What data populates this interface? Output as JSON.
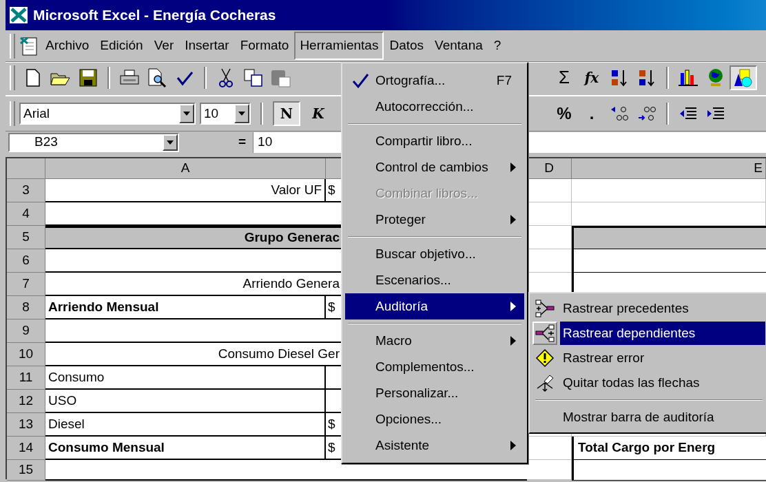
{
  "window": {
    "title": "Microsoft Excel - Energía Cocheras"
  },
  "menu_bar": [
    {
      "label": "Archivo",
      "selected": false
    },
    {
      "label": "Edición",
      "selected": false
    },
    {
      "label": "Ver",
      "selected": false
    },
    {
      "label": "Insertar",
      "selected": false
    },
    {
      "label": "Formato",
      "selected": false
    },
    {
      "label": "Herramientas",
      "selected": true
    },
    {
      "label": "Datos",
      "selected": false
    },
    {
      "label": "Ventana",
      "selected": false
    },
    {
      "label": "?",
      "selected": false
    }
  ],
  "standard_toolbar": {
    "autosum": "Σ",
    "function": "fx"
  },
  "formatting_toolbar": {
    "font": "Arial",
    "size": "10",
    "bold": {
      "label": "N",
      "pressed": true
    },
    "italic": {
      "label": "K",
      "pressed": false
    },
    "percent": "%",
    "comma": "."
  },
  "formula_bar": {
    "name_box": "B23",
    "equals": "=",
    "value": "10"
  },
  "columns": [
    {
      "label": "A"
    },
    {
      "label": "D"
    },
    {
      "label": "E"
    }
  ],
  "rows": [
    {
      "number": "3",
      "a": "Valor UF",
      "kind": "right",
      "b": "$",
      "e_boxed": false,
      "e_shaded": false
    },
    {
      "number": "4",
      "kind": "plain",
      "e_boxed": false,
      "e_shaded": false
    },
    {
      "number": "5",
      "a": "Grupo Generac",
      "kind": "heading",
      "e_boxed": true,
      "e_shaded": true
    },
    {
      "number": "6",
      "kind": "plain",
      "e_boxed": true,
      "e_shaded": false
    },
    {
      "number": "7",
      "a": "Arriendo Genera",
      "kind": "spanning",
      "e_boxed": true,
      "e_shaded": false
    },
    {
      "number": "8",
      "a": "Arriendo Mensual",
      "kind": "bold",
      "b": "$"
    },
    {
      "number": "9",
      "kind": "plain"
    },
    {
      "number": "10",
      "a": "Consumo Diesel Ger",
      "kind": "spanning"
    },
    {
      "number": "11",
      "a": "Consumo",
      "kind": "plain"
    },
    {
      "number": "12",
      "a": "USO",
      "kind": "plain"
    },
    {
      "number": "13",
      "a": "Diesel",
      "kind": "plain",
      "b": "$"
    },
    {
      "number": "14",
      "a": "Consumo Mensual",
      "kind": "bold",
      "b": "$",
      "e": "Total Cargo por Energ",
      "e_boxed": true,
      "e_shaded": false
    },
    {
      "number": "15",
      "kind": "plain",
      "e_boxed": true,
      "e_shaded": false
    }
  ],
  "tools_menu": [
    {
      "kind": "item",
      "label": "Ortografía...",
      "shortcut": "F7",
      "submenu": false,
      "disabled": false,
      "selected": false
    },
    {
      "kind": "item",
      "label": "Autocorrección...",
      "submenu": false,
      "disabled": false,
      "selected": false
    },
    {
      "kind": "separator"
    },
    {
      "kind": "item",
      "label": "Compartir libro...",
      "submenu": false,
      "disabled": false,
      "selected": false
    },
    {
      "kind": "item",
      "label": "Control de cambios",
      "submenu": true,
      "disabled": false,
      "selected": false
    },
    {
      "kind": "item",
      "label": "Combinar libros...",
      "submenu": false,
      "disabled": true,
      "selected": false
    },
    {
      "kind": "item",
      "label": "Proteger",
      "submenu": true,
      "disabled": false,
      "selected": false
    },
    {
      "kind": "separator"
    },
    {
      "kind": "item",
      "label": "Buscar objetivo...",
      "submenu": false,
      "disabled": false,
      "selected": false
    },
    {
      "kind": "item",
      "label": "Escenarios...",
      "submenu": false,
      "disabled": false,
      "selected": false
    },
    {
      "kind": "item",
      "label": "Auditoría",
      "submenu": true,
      "disabled": false,
      "selected": true
    },
    {
      "kind": "separator"
    },
    {
      "kind": "item",
      "label": "Macro",
      "submenu": true,
      "disabled": false,
      "selected": false
    },
    {
      "kind": "item",
      "label": "Complementos...",
      "submenu": false,
      "disabled": false,
      "selected": false
    },
    {
      "kind": "item",
      "label": "Personalizar...",
      "submenu": false,
      "disabled": false,
      "selected": false
    },
    {
      "kind": "item",
      "label": "Opciones...",
      "submenu": false,
      "disabled": false,
      "selected": false
    },
    {
      "kind": "item",
      "label": "Asistente",
      "submenu": true,
      "disabled": false,
      "selected": false
    }
  ],
  "audit_submenu": [
    {
      "kind": "item",
      "label": "Rastrear precedentes",
      "selected": false
    },
    {
      "kind": "item",
      "label": "Rastrear dependientes",
      "selected": true
    },
    {
      "kind": "item",
      "label": "Rastrear error",
      "selected": false
    },
    {
      "kind": "item",
      "label": "Quitar todas las flechas",
      "selected": false
    },
    {
      "kind": "separator"
    },
    {
      "kind": "item",
      "label": "Mostrar barra de auditoría",
      "selected": false
    }
  ]
}
